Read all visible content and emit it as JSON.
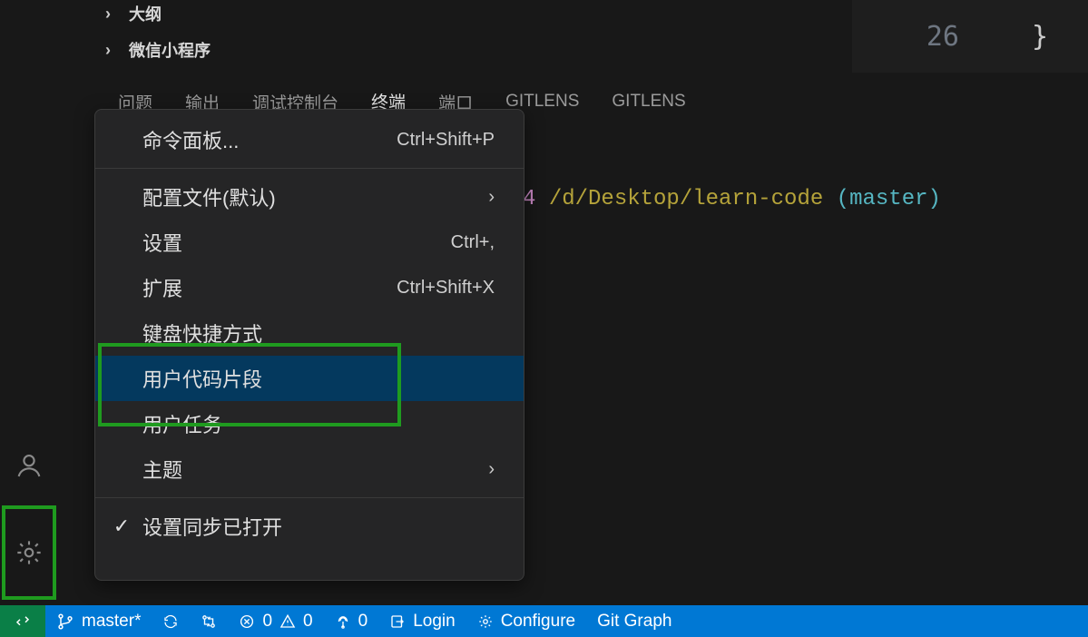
{
  "sidebar_sections": [
    {
      "label": "大纲"
    },
    {
      "label": "微信小程序"
    }
  ],
  "panel_tabs": {
    "problems": "问题",
    "output": "输出",
    "debug_console": "调试控制台",
    "terminal": "终端",
    "ports": "端口",
    "gitlens1": "GITLENS",
    "gitlens2": "GITLENS",
    "active": "终端"
  },
  "editor": {
    "line_number": "26",
    "brace": "}"
  },
  "terminal": {
    "seg1": "4 ",
    "path": "/d/Desktop/learn-code",
    "seg2": " (",
    "branch": "master",
    "seg3": ")"
  },
  "context_menu": {
    "command_palette": {
      "label": "命令面板...",
      "shortcut": "Ctrl+Shift+P"
    },
    "profiles": {
      "label": "配置文件(默认)"
    },
    "settings": {
      "label": "设置",
      "shortcut": "Ctrl+,"
    },
    "extensions": {
      "label": "扩展",
      "shortcut": "Ctrl+Shift+X"
    },
    "keyboard": {
      "label": "键盘快捷方式"
    },
    "snippets": {
      "label": "用户代码片段"
    },
    "tasks": {
      "label": "用户任务"
    },
    "themes": {
      "label": "主题"
    },
    "sync": {
      "label": "设置同步已打开"
    }
  },
  "status": {
    "branch": "master*",
    "errors": "0",
    "warnings": "0",
    "ports": "0",
    "login": "Login",
    "configure": "Configure",
    "git_graph": "Git Graph"
  }
}
